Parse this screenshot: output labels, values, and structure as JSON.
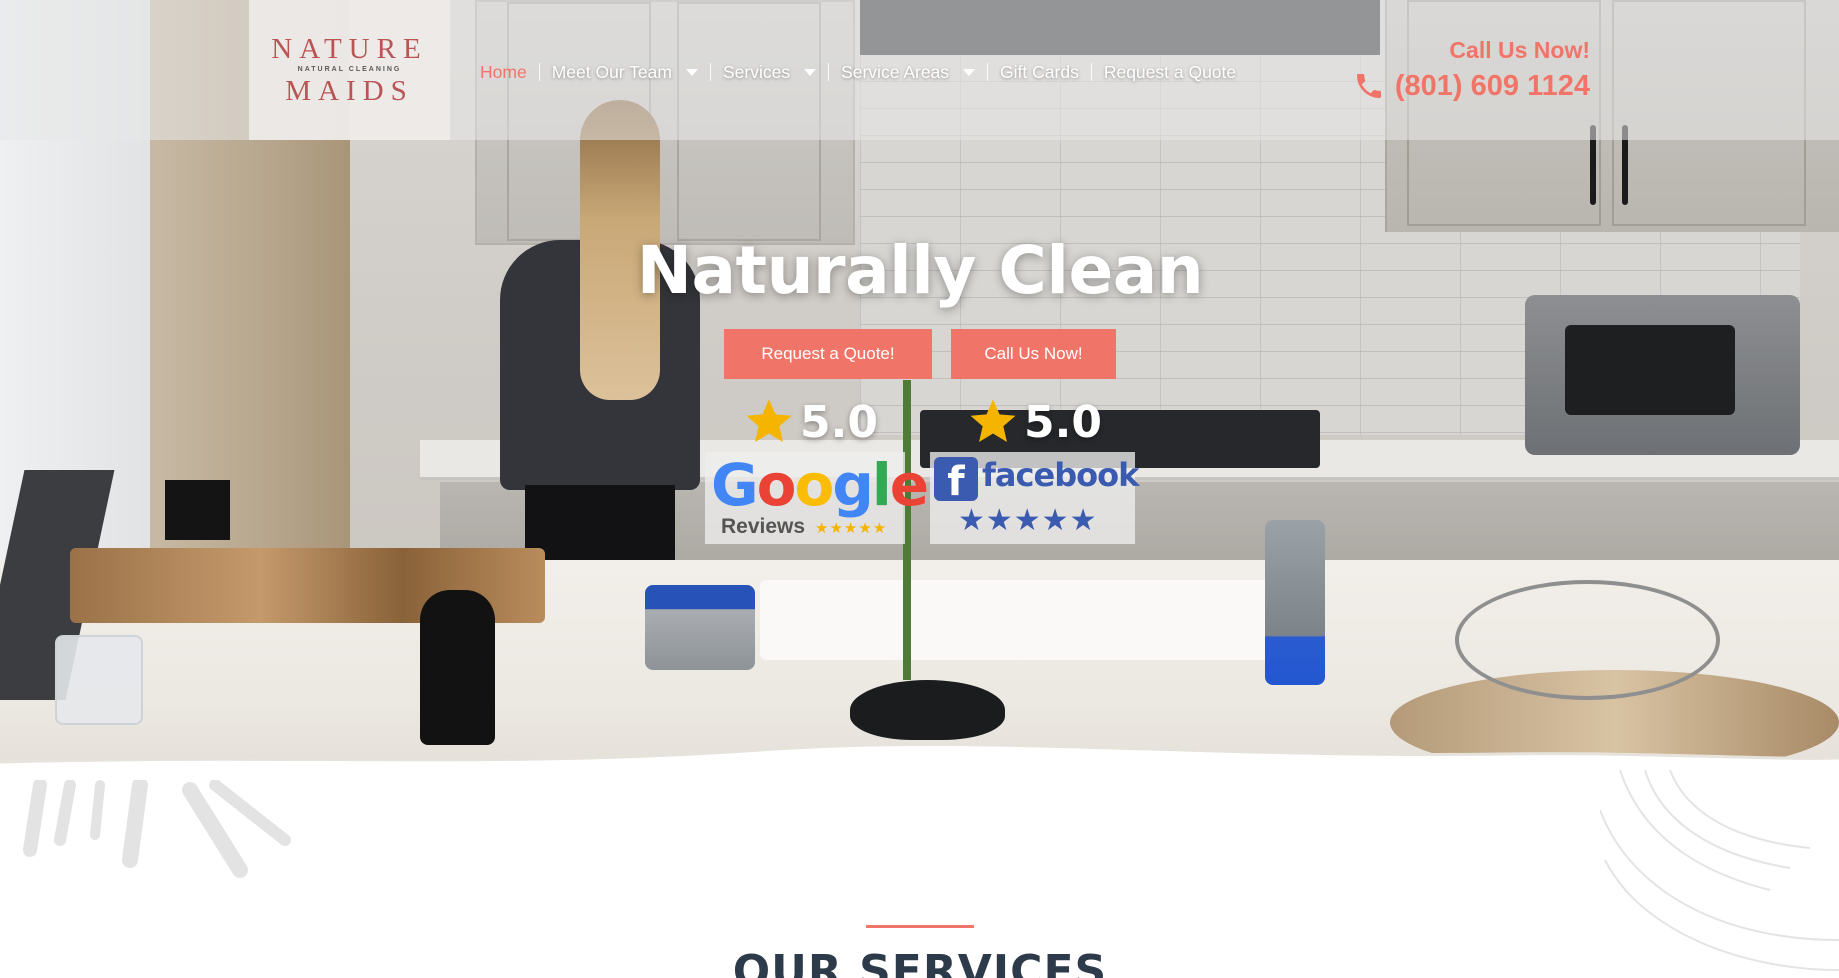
{
  "logo": {
    "line1": "NATURE",
    "line2": "NATURAL CLEANING",
    "line3": "MAIDS"
  },
  "nav": {
    "items": [
      {
        "label": "Home",
        "active": true,
        "dropdown": false
      },
      {
        "label": "Meet Our Team",
        "active": false,
        "dropdown": true
      },
      {
        "label": "Services",
        "active": false,
        "dropdown": true
      },
      {
        "label": "Service Areas",
        "active": false,
        "dropdown": true
      },
      {
        "label": "Gift Cards",
        "active": false,
        "dropdown": false
      },
      {
        "label": "Request a Quote",
        "active": false,
        "dropdown": false
      }
    ]
  },
  "contact": {
    "call_label": "Call Us Now!",
    "phone": "(801) 609 1124",
    "phone_icon": "phone-icon"
  },
  "hero": {
    "title": "Naturally Clean",
    "quote_button": "Request a Quote!",
    "call_button": "Call Us Now!"
  },
  "ratings": {
    "google": {
      "score": "5.0",
      "brand": "Google",
      "sub": "Reviews",
      "stars": "★★★★★"
    },
    "facebook": {
      "score": "5.0",
      "brand": "facebook",
      "stars": "★★★★★"
    }
  },
  "section": {
    "title": "OUR SERVICES"
  },
  "colors": {
    "accent": "#f07568",
    "facebook": "#3b5bb0",
    "star": "#f4b400",
    "heading": "#2d3a4a"
  }
}
